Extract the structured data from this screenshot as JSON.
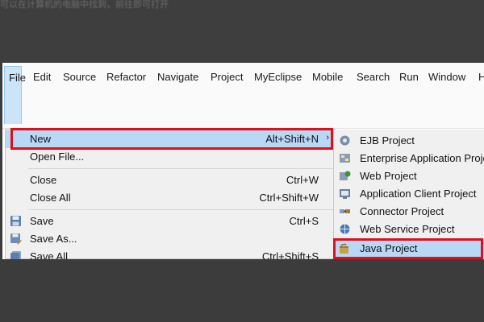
{
  "background_caption": "可以在计算机的电脑中找到，前往即可打开",
  "menubar": {
    "items": [
      "File",
      "Edit",
      "Source",
      "Refactor",
      "Navigate",
      "Project",
      "MyEclipse",
      "Mobile",
      "Search",
      "Run",
      "Window",
      "H"
    ]
  },
  "file_menu": {
    "new": {
      "label": "New",
      "shortcut": "Alt+Shift+N"
    },
    "open_file": {
      "label": "Open File..."
    },
    "close": {
      "label": "Close",
      "shortcut": "Ctrl+W"
    },
    "close_all": {
      "label": "Close All",
      "shortcut": "Ctrl+Shift+W"
    },
    "save": {
      "label": "Save",
      "shortcut": "Ctrl+S"
    },
    "save_as": {
      "label": "Save As..."
    },
    "save_all": {
      "label": "Save All",
      "shortcut": "Ctrl+Shift+S"
    }
  },
  "new_submenu": {
    "items": [
      "EJB Project",
      "Enterprise Application Project",
      "Web Project",
      "Application Client Project",
      "Connector Project",
      "Web Service Project",
      "Java Project"
    ]
  },
  "colors": {
    "highlight_border": "#e0101b",
    "selection": "#b9d8f5"
  }
}
